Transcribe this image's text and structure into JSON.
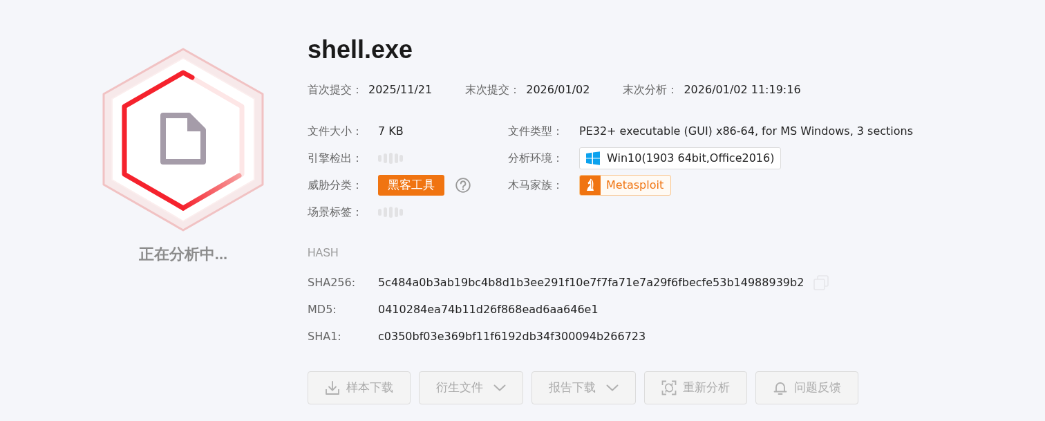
{
  "analysis": {
    "status_text": "正在分析中..."
  },
  "file": {
    "name": "shell.exe"
  },
  "submissions": [
    {
      "label": "首次提交：",
      "value": "2025/11/21"
    },
    {
      "label": "末次提交：",
      "value": "2026/01/02"
    },
    {
      "label": "末次分析：",
      "value": "2026/01/02 11:19:16"
    }
  ],
  "detail_rows": [
    [
      {
        "label": "文件大小：",
        "kind": "text",
        "value": "7 KB"
      },
      {
        "label": "文件类型：",
        "kind": "text",
        "value": "PE32+ executable (GUI) x86-64, for MS Windows, 3 sections"
      }
    ],
    [
      {
        "label": "引擎检出：",
        "kind": "loading"
      },
      {
        "label": "分析环境：",
        "kind": "environment",
        "value": "Win10(1903 64bit,Office2016)"
      }
    ],
    [
      {
        "label": "威胁分类：",
        "kind": "tag",
        "value": "黑客工具",
        "help": true
      },
      {
        "label": "木马家族：",
        "kind": "family",
        "value": "Metasploit"
      }
    ],
    [
      {
        "label": "场景标签：",
        "kind": "loading"
      }
    ]
  ],
  "hash": {
    "title": "HASH",
    "rows": [
      {
        "label": "SHA256:",
        "value": "5c484a0b3ab19bc4b8d1b3ee291f10e7f7fa71e7a29f6fbecfe53b14988939b2",
        "copyable": true
      },
      {
        "label": "MD5:",
        "value": "0410284ea74b11d26f868ead6aa646e1",
        "copyable": false
      },
      {
        "label": "SHA1:",
        "value": "c0350bf03e369bf11f6192db34f300094b266723",
        "copyable": false
      }
    ]
  },
  "actions": [
    {
      "label": "样本下载",
      "dropdown": false,
      "disabled": true
    },
    {
      "label": "衍生文件",
      "dropdown": true,
      "disabled": true
    },
    {
      "label": "报告下载",
      "dropdown": true,
      "disabled": true
    },
    {
      "label": "重新分析",
      "dropdown": false,
      "disabled": true
    },
    {
      "label": "问题反馈",
      "dropdown": false,
      "disabled": true
    }
  ]
}
